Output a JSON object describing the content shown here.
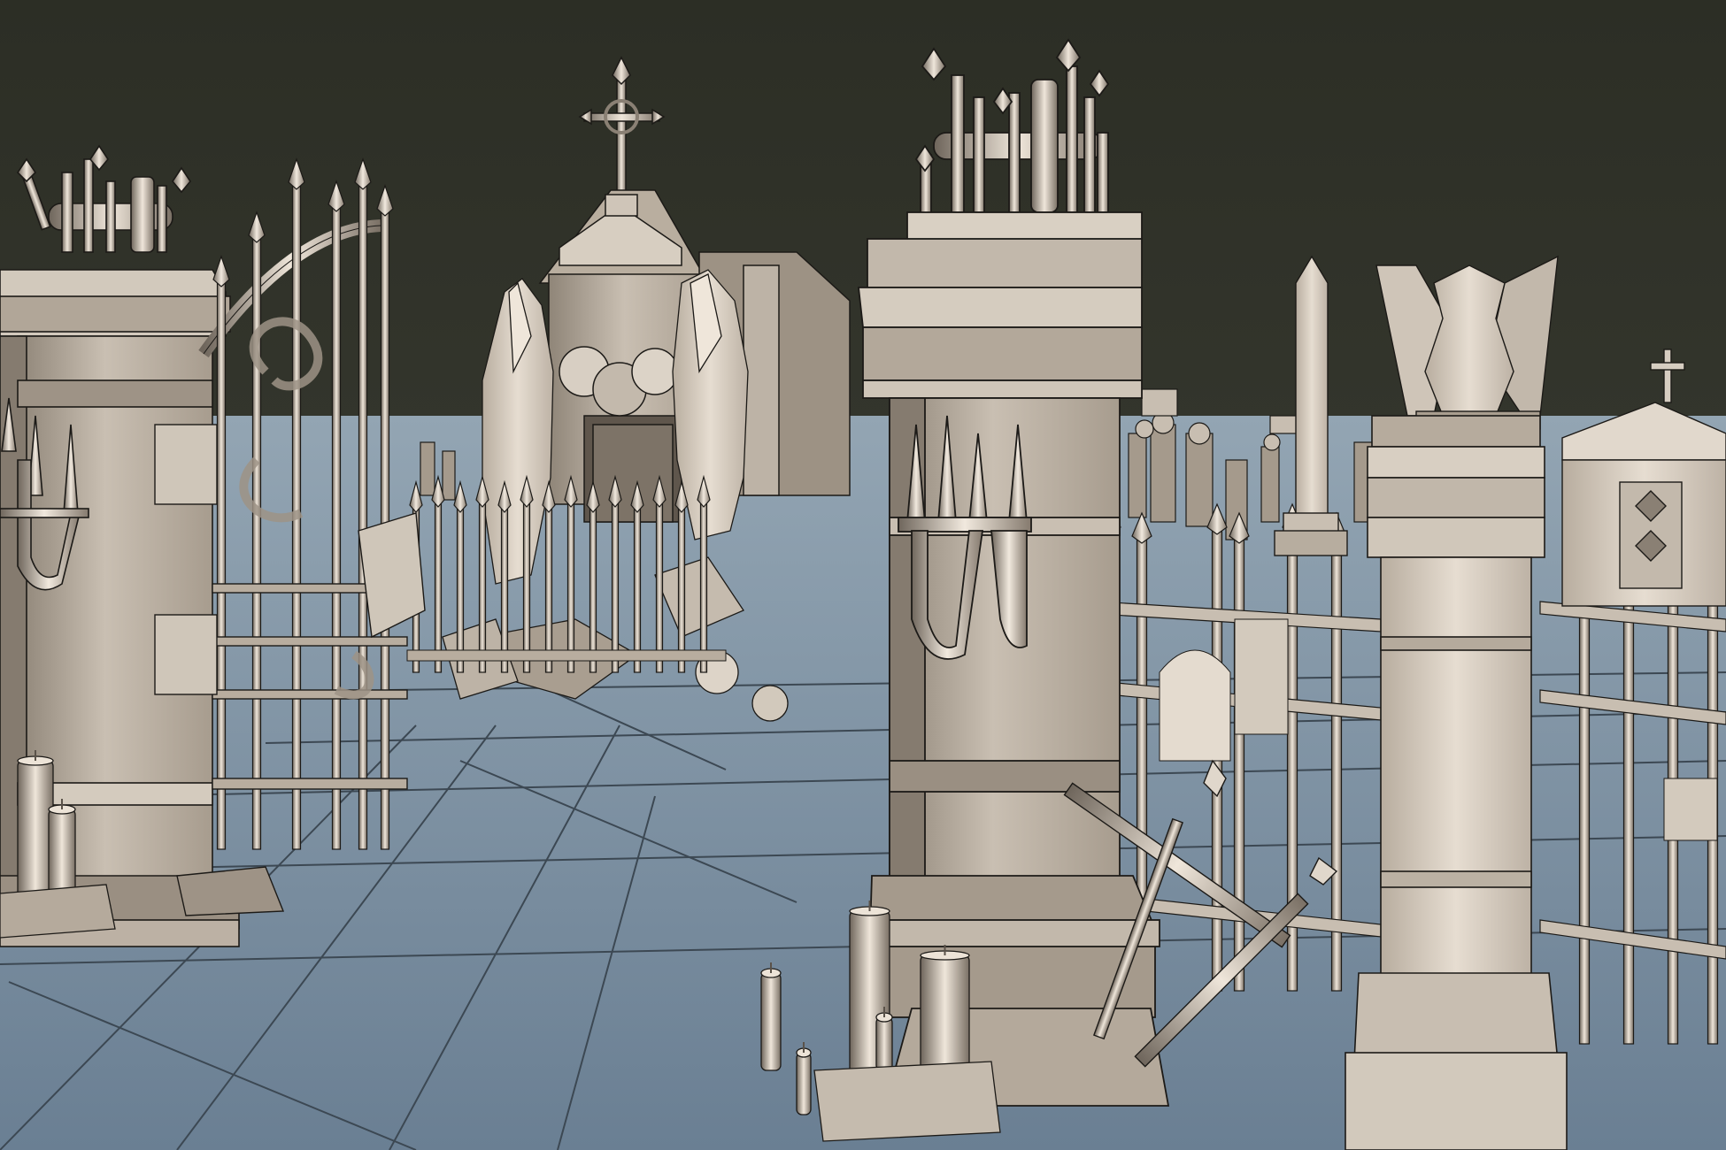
{
  "scene": {
    "colors": {
      "sky": "#2f3128",
      "floor": "#71879b",
      "floor_far": "#8da0b0",
      "grid": "#3d4954",
      "stone_light": "#d9d0c4",
      "stone_mid": "#b6ab9d",
      "stone_dark": "#7e7468",
      "metal_light": "#cfc6bb",
      "metal_dark": "#6b6258",
      "wire": "#1c1a17"
    },
    "objects": [
      "left-gate-pillar",
      "wrought-iron-gate",
      "mausoleum-with-cross",
      "stone-statues",
      "front-right-gate-pillar",
      "right-fence-pillar",
      "gargoyle-statue",
      "obelisk",
      "small-crypt",
      "iron-fence",
      "candles",
      "broken-fence-debris",
      "distant-tombstones"
    ]
  }
}
